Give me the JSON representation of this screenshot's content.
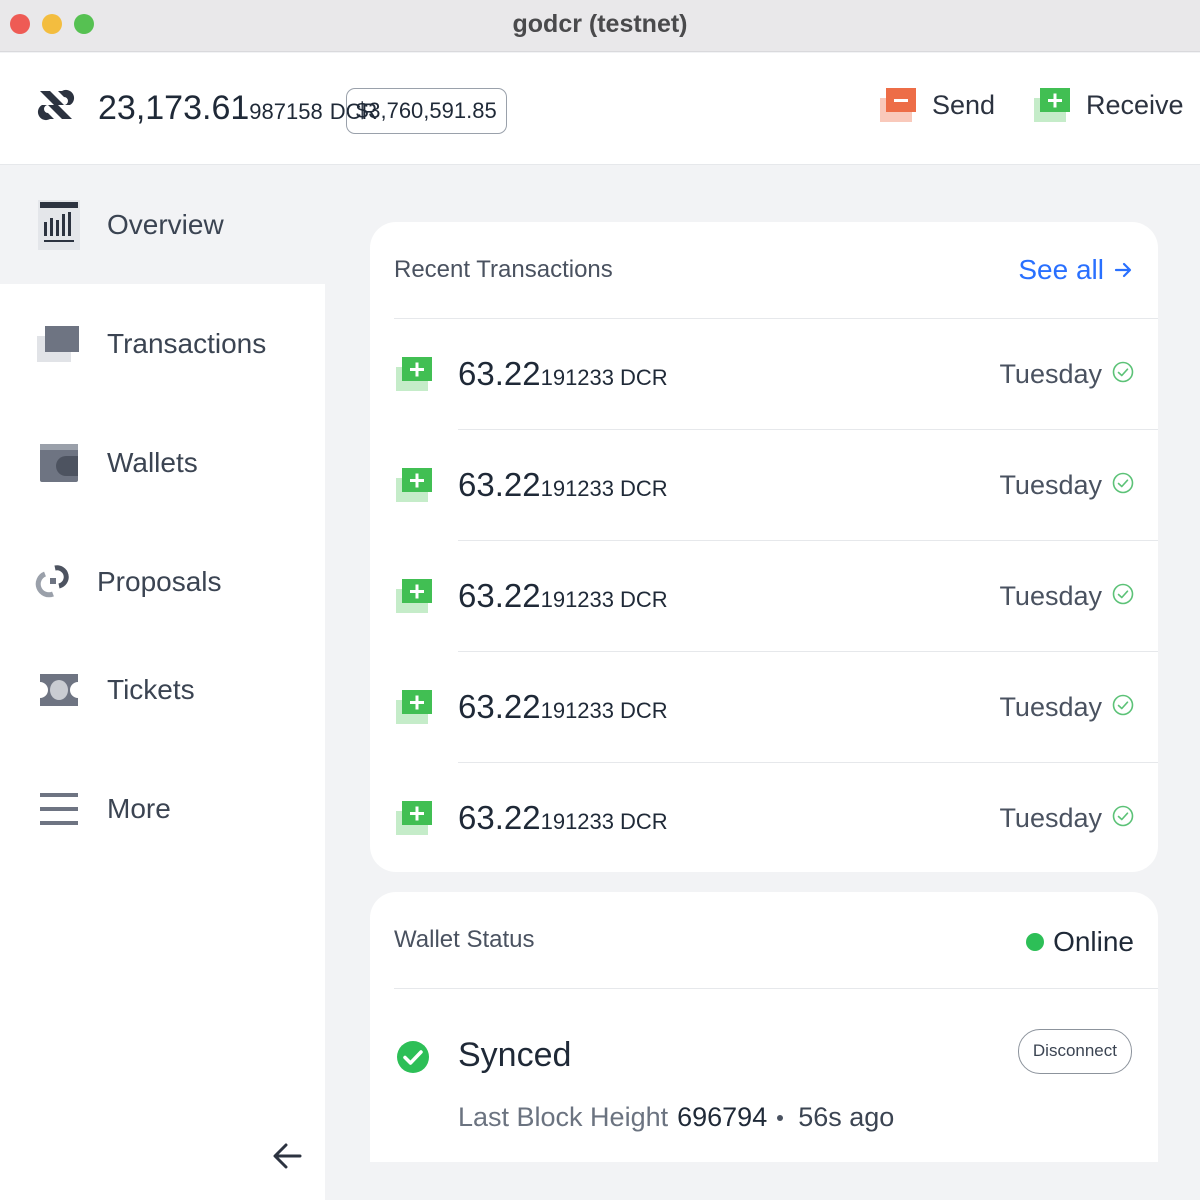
{
  "window": {
    "title": "godcr (testnet)"
  },
  "header": {
    "balance_main": "23,173.61",
    "balance_decimals": "987158",
    "balance_unit": "DCR",
    "usd_value": "$3,760,591.85",
    "send_label": "Send",
    "receive_label": "Receive"
  },
  "sidebar": {
    "items": [
      {
        "label": "Overview",
        "icon": "overview-icon",
        "active": true
      },
      {
        "label": "Transactions",
        "icon": "transactions-icon"
      },
      {
        "label": "Wallets",
        "icon": "wallet-icon"
      },
      {
        "label": "Proposals",
        "icon": "proposals-icon"
      },
      {
        "label": "Tickets",
        "icon": "tickets-icon"
      },
      {
        "label": "More",
        "icon": "menu-icon"
      }
    ]
  },
  "recent_transactions": {
    "title": "Recent Transactions",
    "see_all_label": "See all",
    "rows": [
      {
        "amount_main": "63.22",
        "amount_decimals": "191233",
        "unit": "DCR",
        "date": "Tuesday",
        "status": "confirmed"
      },
      {
        "amount_main": "63.22",
        "amount_decimals": "191233",
        "unit": "DCR",
        "date": "Tuesday",
        "status": "confirmed"
      },
      {
        "amount_main": "63.22",
        "amount_decimals": "191233",
        "unit": "DCR",
        "date": "Tuesday",
        "status": "confirmed"
      },
      {
        "amount_main": "63.22",
        "amount_decimals": "191233",
        "unit": "DCR",
        "date": "Tuesday",
        "status": "confirmed"
      },
      {
        "amount_main": "63.22",
        "amount_decimals": "191233",
        "unit": "DCR",
        "date": "Tuesday",
        "status": "confirmed"
      }
    ]
  },
  "wallet_status": {
    "title": "Wallet Status",
    "connection": "Online",
    "sync_state": "Synced",
    "disconnect_label": "Disconnect",
    "last_block_label": "Last Block Height",
    "last_block_height": "696794",
    "last_block_ago": "56s ago"
  },
  "colors": {
    "accent_blue": "#2970ff",
    "online_green": "#2dbf57",
    "receive_green": "#41bf53",
    "send_red": "#ed6d47"
  }
}
